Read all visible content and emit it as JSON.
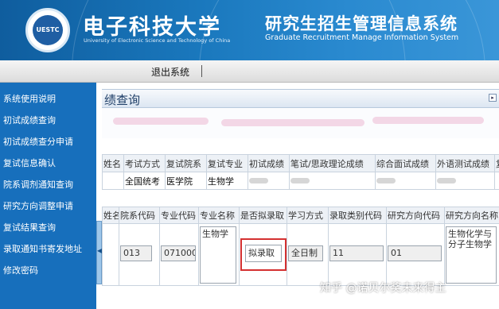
{
  "header": {
    "logo_text": "UESTC",
    "university_cn": "电子科技大学",
    "university_en": "University of Electronic Science and Technology of China",
    "system_cn": "研究生招生管理信息系统",
    "system_en": "Graduate Recruitment Manage Information System",
    "brand_color": "#1a78bd"
  },
  "nav": {
    "logout_label": "退出系统"
  },
  "sidebar": {
    "items": [
      {
        "label": "系统使用说明"
      },
      {
        "label": "初试成绩查询"
      },
      {
        "label": "初试成绩查分申请"
      },
      {
        "label": "复试信息确认"
      },
      {
        "label": "院系调剂通知查询"
      },
      {
        "label": "研究方向调整申请"
      },
      {
        "label": "复试结果查询"
      },
      {
        "label": "录取通知书寄发地址"
      },
      {
        "label": "修改密码"
      }
    ],
    "collapse_icon": "triangle-left-icon"
  },
  "main": {
    "title": "绩查询",
    "title_icon": "arrow-box-icon",
    "score_table": {
      "headers": [
        "姓名",
        "考试方式",
        "复试院系",
        "复试专业",
        "初试成绩",
        "笔试/思政理论成绩",
        "综合面试成绩",
        "外语测试成绩",
        "复"
      ],
      "row": [
        "",
        "全国统考",
        "医学院",
        "生物学",
        "",
        "",
        "",
        "",
        ""
      ]
    },
    "admission_table": {
      "headers": [
        "姓名",
        "院系代码",
        "专业代码",
        "专业名称",
        "是否拟录取",
        "学习方式",
        "录取类别代码",
        "研究方向代码",
        "研究方向名称"
      ],
      "dept_code": "013",
      "major_code": "071000",
      "major_name": "生物学",
      "admission_status": "拟录取",
      "study_mode": "全日制",
      "category_code": "11",
      "direction_code": "01",
      "direction_name": "生物化学与分子生物学"
    }
  },
  "watermark": "知乎 @诺贝尔奖未来得主"
}
